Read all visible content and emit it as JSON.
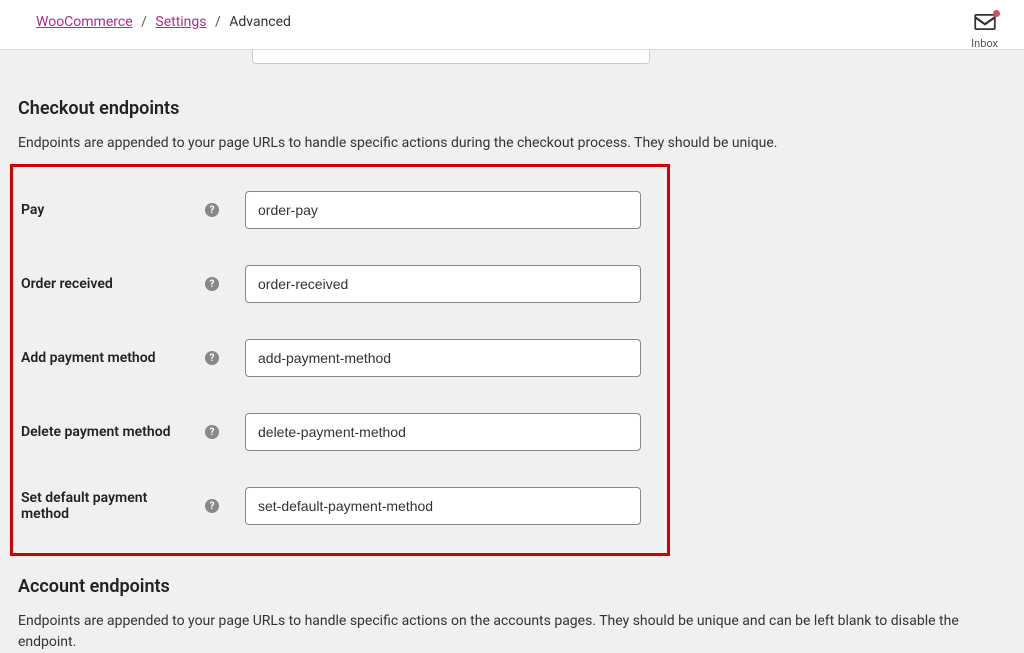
{
  "breadcrumb": {
    "root": "WooCommerce",
    "mid": "Settings",
    "current": "Advanced"
  },
  "inbox": {
    "label": "Inbox"
  },
  "sections": {
    "checkout": {
      "title": "Checkout endpoints",
      "desc": "Endpoints are appended to your page URLs to handle specific actions during the checkout process. They should be unique.",
      "fields": [
        {
          "label": "Pay",
          "value": "order-pay"
        },
        {
          "label": "Order received",
          "value": "order-received"
        },
        {
          "label": "Add payment method",
          "value": "add-payment-method"
        },
        {
          "label": "Delete payment method",
          "value": "delete-payment-method"
        },
        {
          "label": "Set default payment method",
          "value": "set-default-payment-method"
        }
      ]
    },
    "account": {
      "title": "Account endpoints",
      "desc": "Endpoints are appended to your page URLs to handle specific actions on the accounts pages. They should be unique and can be left blank to disable the endpoint."
    }
  }
}
